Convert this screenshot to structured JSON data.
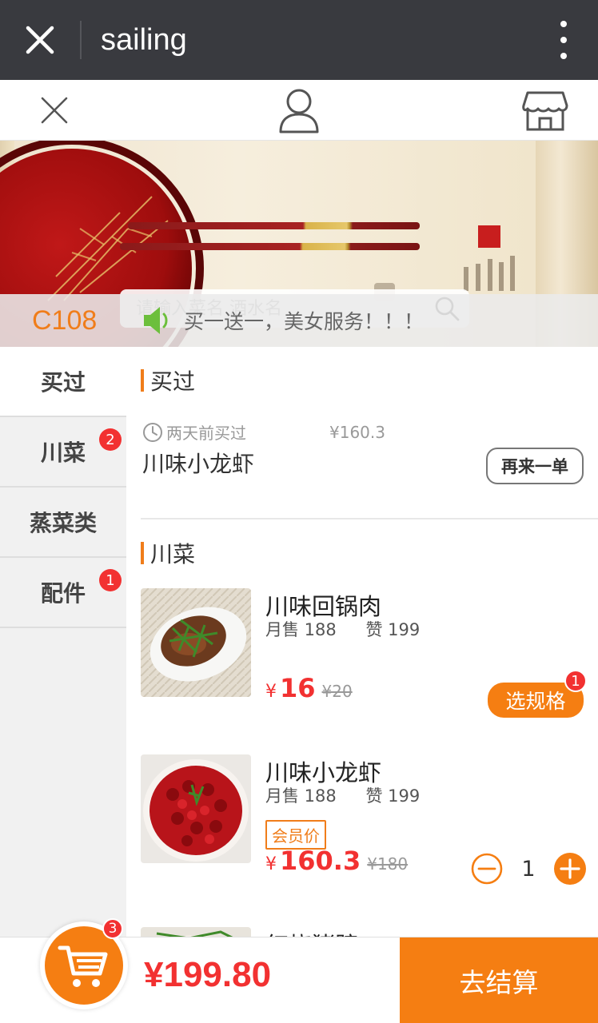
{
  "window": {
    "title": "sailing"
  },
  "search": {
    "placeholder": "请输入菜名 酒水名"
  },
  "notice": {
    "table_no": "C108",
    "text": "买一送一，美女服务！！！"
  },
  "nav": [
    {
      "label": "买过",
      "badge": ""
    },
    {
      "label": "川菜",
      "badge": "2"
    },
    {
      "label": "蒸菜类",
      "badge": ""
    },
    {
      "label": "配件",
      "badge": "1"
    }
  ],
  "bought": {
    "title": "买过",
    "item": {
      "time": "两天前买过",
      "price": "¥160.3",
      "name": "川味小龙虾",
      "reorder_label": "再来一单"
    }
  },
  "sichuan": {
    "title": "川菜",
    "dishes": [
      {
        "name": "川味回锅肉",
        "sales": "月售 188",
        "likes": "赞 199",
        "currency": "¥",
        "price": "16",
        "orig": "¥20",
        "spec_label": "选规格",
        "spec_badge": "1"
      },
      {
        "name": "川味小龙虾",
        "sales": "月售 188",
        "likes": "赞 199",
        "member": "会员价",
        "currency": "¥",
        "price": "160.3",
        "orig": "¥180",
        "qty": "1"
      },
      {
        "name": "红烧猪蹄"
      }
    ]
  },
  "cart": {
    "count": "3",
    "total": "¥199.80",
    "checkout_label": "去结算"
  },
  "colors": {
    "accent": "#f57e12",
    "price": "#f23131",
    "titlebar": "#393a3f"
  }
}
